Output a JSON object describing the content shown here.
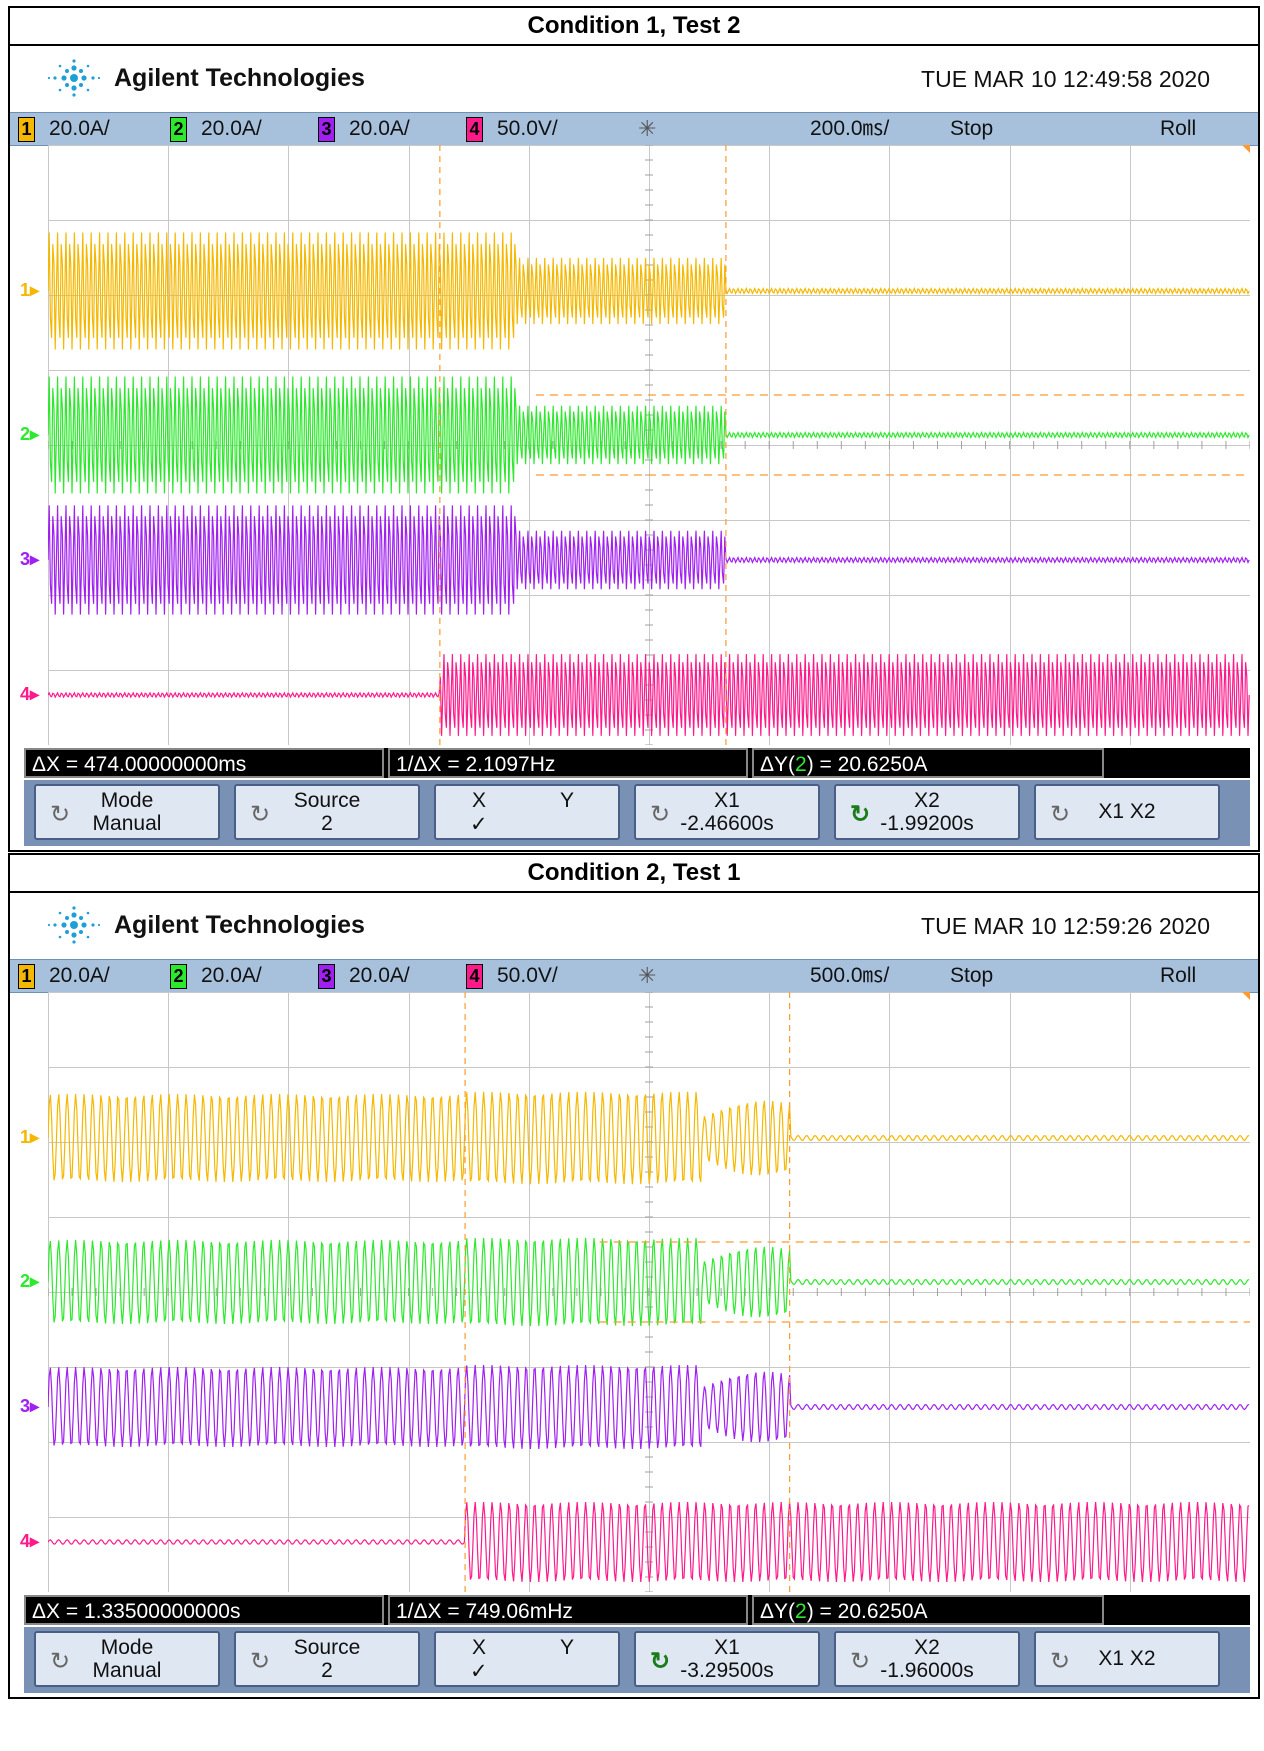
{
  "panels": [
    {
      "title": "Condition 1, Test 2",
      "brand": "Agilent Technologies",
      "timestamp": "TUE MAR 10 12:49:58 2020",
      "channels": [
        {
          "num": "1",
          "scale": "20.0A/",
          "color": "#f5b800"
        },
        {
          "num": "2",
          "scale": "20.0A/",
          "color": "#2ee82e"
        },
        {
          "num": "3",
          "scale": "20.0A/",
          "color": "#a020f0"
        },
        {
          "num": "4",
          "scale": "50.0V/",
          "color": "#ff1a8c"
        }
      ],
      "timebase": "200.0㎳/",
      "run_state": "Stop",
      "mode": "Roll",
      "measure": {
        "dx": "ΔX = 474.00000000ms",
        "inv_dx": "1/ΔX = 2.1097Hz",
        "dy_pre": "ΔY(",
        "dy_ch": "2",
        "dy_post": ") = 20.6250A"
      },
      "softkeys": {
        "mode_l1": "Mode",
        "mode_l2": "Manual",
        "source_l1": "Source",
        "source_l2": "2",
        "xy_l1x": "X",
        "xy_l1y": "Y",
        "xy_l2": "✓",
        "x1_l1": "X1",
        "x1_l2": "-2.46600s",
        "x2_l1": "X2",
        "x2_l2": "-1.99200s",
        "x1x2": "X1 X2",
        "active": "x2"
      },
      "traces": {
        "cursor_x1_frac": 0.326,
        "cursor_x2_frac": 0.564,
        "events": [
          0.326,
          0.39,
          0.564
        ]
      }
    },
    {
      "title": "Condition 2, Test 1",
      "brand": "Agilent Technologies",
      "timestamp": "TUE MAR 10 12:59:26 2020",
      "channels": [
        {
          "num": "1",
          "scale": "20.0A/",
          "color": "#f5b800"
        },
        {
          "num": "2",
          "scale": "20.0A/",
          "color": "#2ee82e"
        },
        {
          "num": "3",
          "scale": "20.0A/",
          "color": "#a020f0"
        },
        {
          "num": "4",
          "scale": "50.0V/",
          "color": "#ff1a8c"
        }
      ],
      "timebase": "500.0㎳/",
      "run_state": "Stop",
      "mode": "Roll",
      "measure": {
        "dx": "ΔX = 1.33500000000s",
        "inv_dx": "1/ΔX = 749.06mHz",
        "dy_pre": "ΔY(",
        "dy_ch": "2",
        "dy_post": ") = 20.6250A"
      },
      "softkeys": {
        "mode_l1": "Mode",
        "mode_l2": "Manual",
        "source_l1": "Source",
        "source_l2": "2",
        "xy_l1x": "X",
        "xy_l1y": "Y",
        "xy_l2": "✓",
        "x1_l1": "X1",
        "x1_l2": "-3.29500s",
        "x2_l1": "X2",
        "x2_l2": "-1.96000s",
        "x1x2": "X1 X2",
        "active": "x1"
      },
      "traces": {
        "cursor_x1_frac": 0.347,
        "cursor_x2_frac": 0.617,
        "events": [
          0.347,
          0.544,
          0.617
        ]
      }
    }
  ]
}
